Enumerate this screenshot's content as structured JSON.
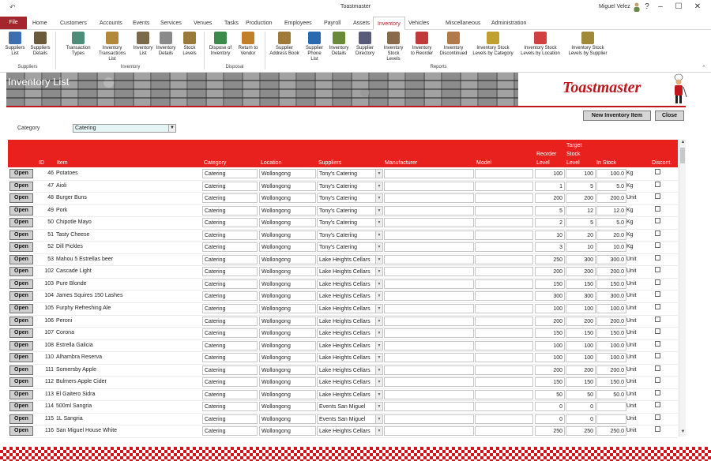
{
  "window": {
    "title": "Toastmaster",
    "user": "Miguel Velez",
    "qa_icon": "undo-icon"
  },
  "tabs": [
    "File",
    "Home",
    "Customers",
    "Accounts",
    "Events",
    "Services",
    "Venues",
    "Tasks",
    "Production",
    "Employees",
    "Payroll",
    "Assets",
    "Inventory",
    "Vehicles",
    "Miscellaneous",
    "Administration"
  ],
  "active_tab": "Inventory",
  "ribbon": {
    "groups": [
      "Suppliers",
      "Inventory",
      "Disposal",
      "Reports"
    ],
    "buttons": [
      {
        "label1": "Suppliers",
        "label2": "List",
        "color": "#3a6fb0"
      },
      {
        "label1": "Suppliers",
        "label2": "Details",
        "color": "#6b5a3a"
      },
      {
        "label1": "Transaction",
        "label2": "Types",
        "color": "#4b8f7a"
      },
      {
        "label1": "Inventory",
        "label2": "Transactions List",
        "color": "#b08a3a"
      },
      {
        "label1": "Inventory",
        "label2": "List",
        "color": "#7a6a4a"
      },
      {
        "label1": "Inventory",
        "label2": "Details",
        "color": "#8a8a8a"
      },
      {
        "label1": "Stock",
        "label2": "Levels",
        "color": "#9a7a3a"
      },
      {
        "label1": "Dispose of",
        "label2": "Inventory",
        "color": "#3a8a4a"
      },
      {
        "label1": "Return to",
        "label2": "Vendor",
        "color": "#c0802a"
      },
      {
        "label1": "Supplier",
        "label2": "Address Book",
        "color": "#a07a3a"
      },
      {
        "label1": "Supplier",
        "label2": "Phone List",
        "color": "#2a6ab0"
      },
      {
        "label1": "Inventory",
        "label2": "Details",
        "color": "#6a8a3a"
      },
      {
        "label1": "Supplier",
        "label2": "Directory",
        "color": "#5a5a7a"
      },
      {
        "label1": "Inventory",
        "label2": "Stock Levels",
        "color": "#8a6a4a"
      },
      {
        "label1": "Inventory",
        "label2": "to Reorder",
        "color": "#c03a3a"
      },
      {
        "label1": "Inventory",
        "label2": "Discontinued",
        "color": "#b07a4a"
      },
      {
        "label1": "Inventory Stock",
        "label2": "Levels by Category",
        "color": "#c0a030"
      },
      {
        "label1": "Inventory Stock",
        "label2": "Levels by Location",
        "color": "#d04040"
      },
      {
        "label1": "Inventory Stock",
        "label2": "Levels by Supplier",
        "color": "#a08a3a"
      }
    ]
  },
  "page": {
    "title": "Inventory List",
    "brand": "Toastmaster"
  },
  "actions": {
    "new_item": "New Inventory Item",
    "close": "Close"
  },
  "filter": {
    "label": "Category",
    "value": "Catering"
  },
  "columns": {
    "id": "ID",
    "item": "Item",
    "category": "Category",
    "location": "Location",
    "suppliers": "Suppliers",
    "manufacturer": "Manufacturer",
    "model": "Model",
    "reorder1": "Reorder",
    "reorder2": "Level",
    "target1": "Target",
    "target2": "Stock",
    "target3": "Level",
    "instock": "In Stock",
    "discont": "Discont."
  },
  "open_label": "Open",
  "rows": [
    {
      "id": "46",
      "item": "Potatoes",
      "category": "Catering",
      "location": "Wollongong",
      "supplier": "Tony's Catering",
      "reorder": "100",
      "target": "100",
      "instock": "100.0",
      "unit": "Kg"
    },
    {
      "id": "47",
      "item": "Aioli",
      "category": "Catering",
      "location": "Wollongong",
      "supplier": "Tony's Catering",
      "reorder": "1",
      "target": "5",
      "instock": "5.0",
      "unit": "Kg"
    },
    {
      "id": "48",
      "item": "Burger Buns",
      "category": "Catering",
      "location": "Wollongong",
      "supplier": "Tony's Catering",
      "reorder": "200",
      "target": "200",
      "instock": "200.0",
      "unit": "Unit"
    },
    {
      "id": "49",
      "item": "Pork",
      "category": "Catering",
      "location": "Wollongong",
      "supplier": "Tony's Catering",
      "reorder": "5",
      "target": "12",
      "instock": "12.0",
      "unit": "Kg"
    },
    {
      "id": "50",
      "item": "Chipotle Mayo",
      "category": "Catering",
      "location": "Wollongong",
      "supplier": "Tony's Catering",
      "reorder": "2",
      "target": "5",
      "instock": "5.0",
      "unit": "Kg"
    },
    {
      "id": "51",
      "item": "Tasty Cheese",
      "category": "Catering",
      "location": "Wollongong",
      "supplier": "Tony's Catering",
      "reorder": "10",
      "target": "20",
      "instock": "20.0",
      "unit": "Kg"
    },
    {
      "id": "52",
      "item": "Dill Pickles",
      "category": "Catering",
      "location": "Wollongong",
      "supplier": "Tony's Catering",
      "reorder": "3",
      "target": "10",
      "instock": "10.0",
      "unit": "Kg"
    },
    {
      "id": "53",
      "item": "Mahou 5 Estrellas beer",
      "category": "Catering",
      "location": "Wollongong",
      "supplier": "Lake Heights Cellars",
      "reorder": "250",
      "target": "300",
      "instock": "300.0",
      "unit": "Unit"
    },
    {
      "id": "102",
      "item": "Cascade Light",
      "category": "Catering",
      "location": "Wollongong",
      "supplier": "Lake Heights Cellars",
      "reorder": "200",
      "target": "200",
      "instock": "200.0",
      "unit": "Unit"
    },
    {
      "id": "103",
      "item": "Pure Blonde",
      "category": "Catering",
      "location": "Wollongong",
      "supplier": "Lake Heights Cellars",
      "reorder": "150",
      "target": "150",
      "instock": "150.0",
      "unit": "Unit"
    },
    {
      "id": "104",
      "item": "James Squires 150 Lashes",
      "category": "Catering",
      "location": "Wollongong",
      "supplier": "Lake Heights Cellars",
      "reorder": "300",
      "target": "300",
      "instock": "300.0",
      "unit": "Unit"
    },
    {
      "id": "105",
      "item": "Furphy Refreshing Ale",
      "category": "Catering",
      "location": "Wollongong",
      "supplier": "Lake Heights Cellars",
      "reorder": "100",
      "target": "100",
      "instock": "100.0",
      "unit": "Unit"
    },
    {
      "id": "106",
      "item": "Peroni",
      "category": "Catering",
      "location": "Wollongong",
      "supplier": "Lake Heights Cellars",
      "reorder": "200",
      "target": "200",
      "instock": "200.0",
      "unit": "Unit"
    },
    {
      "id": "107",
      "item": "Corona",
      "category": "Catering",
      "location": "Wollongong",
      "supplier": "Lake Heights Cellars",
      "reorder": "150",
      "target": "150",
      "instock": "150.0",
      "unit": "Unit"
    },
    {
      "id": "108",
      "item": "Estrella Galicia",
      "category": "Catering",
      "location": "Wollongong",
      "supplier": "Lake Heights Cellars",
      "reorder": "100",
      "target": "100",
      "instock": "100.0",
      "unit": "Unit"
    },
    {
      "id": "110",
      "item": "Alhambra Reserva",
      "category": "Catering",
      "location": "Wollongong",
      "supplier": "Lake Heights Cellars",
      "reorder": "100",
      "target": "100",
      "instock": "100.0",
      "unit": "Unit"
    },
    {
      "id": "111",
      "item": "Somersby Apple",
      "category": "Catering",
      "location": "Wollongong",
      "supplier": "Lake Heights Cellars",
      "reorder": "200",
      "target": "200",
      "instock": "200.0",
      "unit": "Unit"
    },
    {
      "id": "112",
      "item": "Bulmers Apple Cider",
      "category": "Catering",
      "location": "Wollongong",
      "supplier": "Lake Heights Cellars",
      "reorder": "150",
      "target": "150",
      "instock": "150.0",
      "unit": "Unit"
    },
    {
      "id": "113",
      "item": "El Gaitero Sidra",
      "category": "Catering",
      "location": "Wollongong",
      "supplier": "Lake Heights Cellars",
      "reorder": "50",
      "target": "50",
      "instock": "50.0",
      "unit": "Unit"
    },
    {
      "id": "114",
      "item": "500ml Sangria",
      "category": "Catering",
      "location": "Wollongong",
      "supplier": "Events San Miguel",
      "reorder": "0",
      "target": "0",
      "instock": "",
      "unit": "Unit"
    },
    {
      "id": "115",
      "item": "1L Sangria",
      "category": "Catering",
      "location": "Wollongong",
      "supplier": "Events San Miguel",
      "reorder": "0",
      "target": "0",
      "instock": "",
      "unit": "Unit"
    },
    {
      "id": "116",
      "item": "San Miguel House White",
      "category": "Catering",
      "location": "Wollongong",
      "supplier": "Lake Heights Cellars",
      "reorder": "250",
      "target": "250",
      "instock": "250.0",
      "unit": "Unit"
    }
  ]
}
